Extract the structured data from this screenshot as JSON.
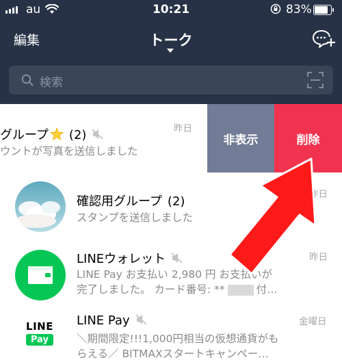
{
  "status_bar": {
    "carrier": "au",
    "time": "10:21",
    "battery": "83%",
    "battery_level": 0.83
  },
  "header": {
    "edit_label": "編集",
    "title": "トーク"
  },
  "search": {
    "placeholder": "検索"
  },
  "swipe_actions": {
    "hide_label": "非表示",
    "delete_label": "削除",
    "colors": {
      "hide": "#727c96",
      "delete": "#f2334f"
    }
  },
  "chats": [
    {
      "name": "グループ",
      "count": "(2)",
      "message": "ウントが写真を送信しました",
      "date": "昨日"
    },
    {
      "name": "確認用グループ",
      "count": "(2)",
      "message": "スタンプを送信しました",
      "date": "昨日"
    },
    {
      "name": "LINEウォレット",
      "message_line1": "LINE Pay お支払い 2,980 円 お支払いが",
      "message_line2a": "完了しました。 カード番号: **",
      "message_line2b": "付…",
      "date": "昨日"
    },
    {
      "name": "LINE Pay",
      "logo_top": "LINE",
      "logo_bottom": "Pay",
      "message_line1": "＼期間限定!!!1,000円相当の仮想通貨がも",
      "message_line2": "らえる／ BITMAXスタートキャンペー…",
      "date": "金曜日"
    }
  ],
  "colors": {
    "header_bg": "#273246",
    "line_green": "#06c755",
    "arrow_red": "#ff1a1a"
  }
}
